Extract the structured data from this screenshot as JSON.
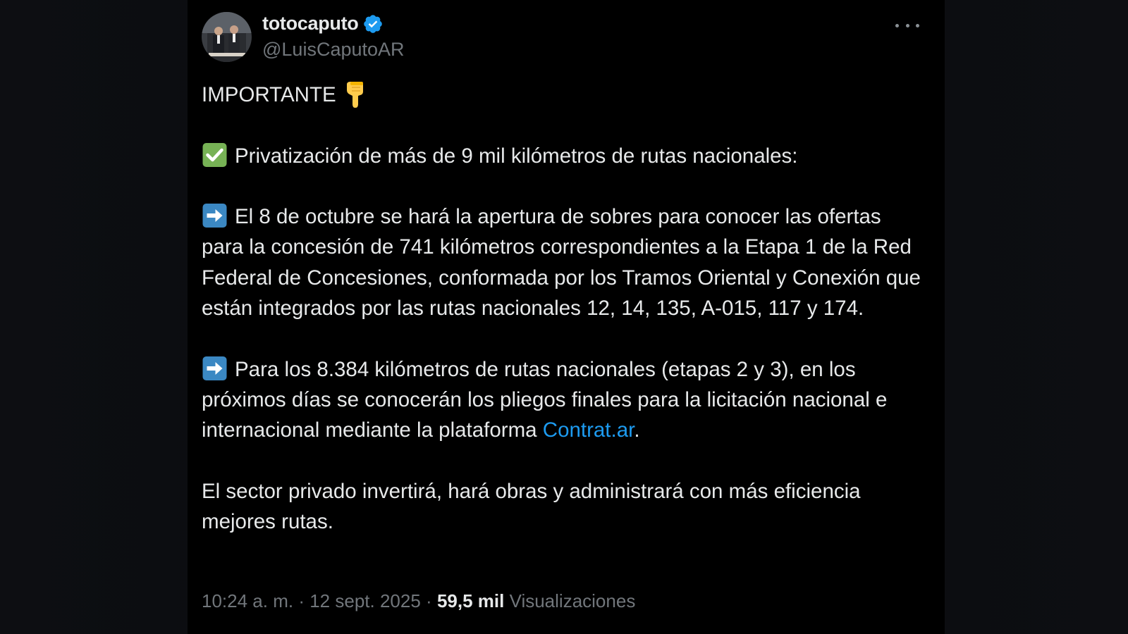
{
  "author": {
    "display_name": "totocaputo",
    "handle": "@LuisCaputoAR",
    "verified": true
  },
  "tweet": {
    "intro": "IMPORTANTE",
    "heading": "Privatización de más de 9 mil kilómetros de rutas nacionales:",
    "point1": "El 8 de octubre se hará la apertura de sobres para conocer las ofertas para la concesión de 741 kilómetros correspondientes a la Etapa 1 de la Red Federal de Concesiones, conformada por los Tramos Oriental y Conexión que están integrados por las rutas nacionales 12, 14, 135, A-015, 117 y 174.",
    "point2_before_link": "Para los 8.384 kilómetros de rutas nacionales (etapas 2 y 3), en los próximos días se conocerán los pliegos finales para la licitación nacional e internacional mediante la plataforma ",
    "point2_link": "Contrat.ar",
    "point2_after_link": ".",
    "closing": "El sector privado invertirá, hará obras y administrará con más eficiencia mejores rutas."
  },
  "meta": {
    "time": "10:24 a. m.",
    "separator": "·",
    "date": "12 sept. 2025",
    "views_count": "59,5 mil",
    "views_label": "Visualizaciones"
  },
  "icons": {
    "intro_emoji": "backhand-index-pointing-down",
    "heading_emoji": "check-mark-button",
    "bullet_emoji": "right-arrow",
    "more": "more-dots-icon",
    "verified": "verified-badge-icon"
  },
  "colors": {
    "background": "#000000",
    "text": "#e7e9ea",
    "secondary_text": "#71767b",
    "link": "#1d9bf0",
    "verified": "#1d9bf0"
  }
}
